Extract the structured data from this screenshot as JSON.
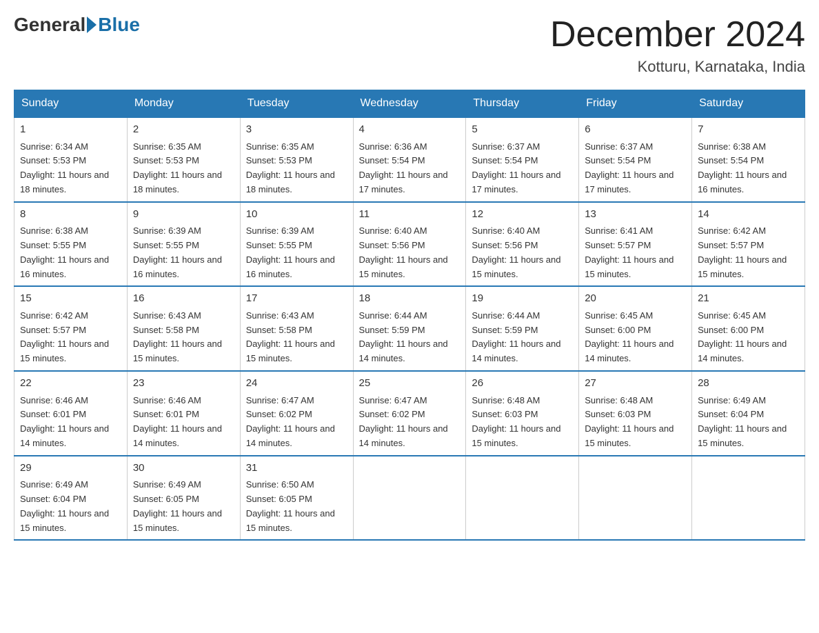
{
  "header": {
    "logo_general": "General",
    "logo_blue": "Blue",
    "month_title": "December 2024",
    "location": "Kotturu, Karnataka, India"
  },
  "weekdays": [
    "Sunday",
    "Monday",
    "Tuesday",
    "Wednesday",
    "Thursday",
    "Friday",
    "Saturday"
  ],
  "weeks": [
    [
      {
        "day": "1",
        "sunrise": "6:34 AM",
        "sunset": "5:53 PM",
        "daylight": "11 hours and 18 minutes."
      },
      {
        "day": "2",
        "sunrise": "6:35 AM",
        "sunset": "5:53 PM",
        "daylight": "11 hours and 18 minutes."
      },
      {
        "day": "3",
        "sunrise": "6:35 AM",
        "sunset": "5:53 PM",
        "daylight": "11 hours and 18 minutes."
      },
      {
        "day": "4",
        "sunrise": "6:36 AM",
        "sunset": "5:54 PM",
        "daylight": "11 hours and 17 minutes."
      },
      {
        "day": "5",
        "sunrise": "6:37 AM",
        "sunset": "5:54 PM",
        "daylight": "11 hours and 17 minutes."
      },
      {
        "day": "6",
        "sunrise": "6:37 AM",
        "sunset": "5:54 PM",
        "daylight": "11 hours and 17 minutes."
      },
      {
        "day": "7",
        "sunrise": "6:38 AM",
        "sunset": "5:54 PM",
        "daylight": "11 hours and 16 minutes."
      }
    ],
    [
      {
        "day": "8",
        "sunrise": "6:38 AM",
        "sunset": "5:55 PM",
        "daylight": "11 hours and 16 minutes."
      },
      {
        "day": "9",
        "sunrise": "6:39 AM",
        "sunset": "5:55 PM",
        "daylight": "11 hours and 16 minutes."
      },
      {
        "day": "10",
        "sunrise": "6:39 AM",
        "sunset": "5:55 PM",
        "daylight": "11 hours and 16 minutes."
      },
      {
        "day": "11",
        "sunrise": "6:40 AM",
        "sunset": "5:56 PM",
        "daylight": "11 hours and 15 minutes."
      },
      {
        "day": "12",
        "sunrise": "6:40 AM",
        "sunset": "5:56 PM",
        "daylight": "11 hours and 15 minutes."
      },
      {
        "day": "13",
        "sunrise": "6:41 AM",
        "sunset": "5:57 PM",
        "daylight": "11 hours and 15 minutes."
      },
      {
        "day": "14",
        "sunrise": "6:42 AM",
        "sunset": "5:57 PM",
        "daylight": "11 hours and 15 minutes."
      }
    ],
    [
      {
        "day": "15",
        "sunrise": "6:42 AM",
        "sunset": "5:57 PM",
        "daylight": "11 hours and 15 minutes."
      },
      {
        "day": "16",
        "sunrise": "6:43 AM",
        "sunset": "5:58 PM",
        "daylight": "11 hours and 15 minutes."
      },
      {
        "day": "17",
        "sunrise": "6:43 AM",
        "sunset": "5:58 PM",
        "daylight": "11 hours and 15 minutes."
      },
      {
        "day": "18",
        "sunrise": "6:44 AM",
        "sunset": "5:59 PM",
        "daylight": "11 hours and 14 minutes."
      },
      {
        "day": "19",
        "sunrise": "6:44 AM",
        "sunset": "5:59 PM",
        "daylight": "11 hours and 14 minutes."
      },
      {
        "day": "20",
        "sunrise": "6:45 AM",
        "sunset": "6:00 PM",
        "daylight": "11 hours and 14 minutes."
      },
      {
        "day": "21",
        "sunrise": "6:45 AM",
        "sunset": "6:00 PM",
        "daylight": "11 hours and 14 minutes."
      }
    ],
    [
      {
        "day": "22",
        "sunrise": "6:46 AM",
        "sunset": "6:01 PM",
        "daylight": "11 hours and 14 minutes."
      },
      {
        "day": "23",
        "sunrise": "6:46 AM",
        "sunset": "6:01 PM",
        "daylight": "11 hours and 14 minutes."
      },
      {
        "day": "24",
        "sunrise": "6:47 AM",
        "sunset": "6:02 PM",
        "daylight": "11 hours and 14 minutes."
      },
      {
        "day": "25",
        "sunrise": "6:47 AM",
        "sunset": "6:02 PM",
        "daylight": "11 hours and 14 minutes."
      },
      {
        "day": "26",
        "sunrise": "6:48 AM",
        "sunset": "6:03 PM",
        "daylight": "11 hours and 15 minutes."
      },
      {
        "day": "27",
        "sunrise": "6:48 AM",
        "sunset": "6:03 PM",
        "daylight": "11 hours and 15 minutes."
      },
      {
        "day": "28",
        "sunrise": "6:49 AM",
        "sunset": "6:04 PM",
        "daylight": "11 hours and 15 minutes."
      }
    ],
    [
      {
        "day": "29",
        "sunrise": "6:49 AM",
        "sunset": "6:04 PM",
        "daylight": "11 hours and 15 minutes."
      },
      {
        "day": "30",
        "sunrise": "6:49 AM",
        "sunset": "6:05 PM",
        "daylight": "11 hours and 15 minutes."
      },
      {
        "day": "31",
        "sunrise": "6:50 AM",
        "sunset": "6:05 PM",
        "daylight": "11 hours and 15 minutes."
      },
      null,
      null,
      null,
      null
    ]
  ]
}
